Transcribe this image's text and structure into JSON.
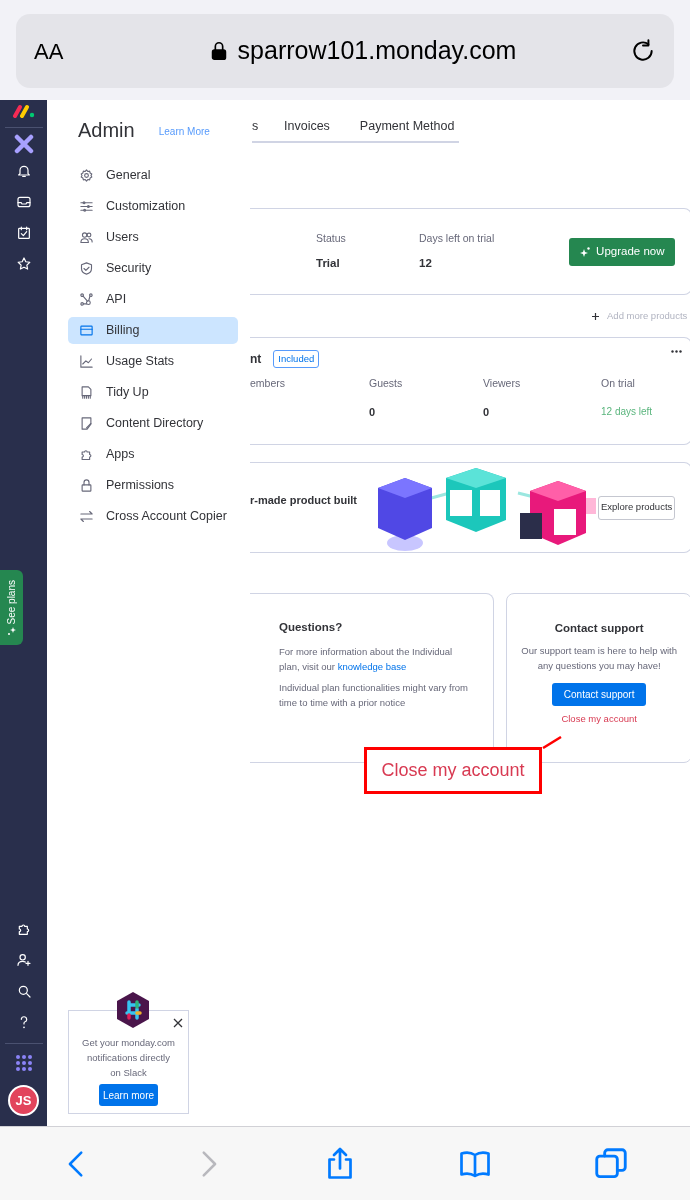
{
  "browser": {
    "text_size_label": "AA",
    "url": "sparrow101.monday.com"
  },
  "rail": {
    "see_plans": "See plans",
    "avatar": "JS"
  },
  "admin": {
    "title": "Admin",
    "learn_more": "Learn More",
    "menu": [
      {
        "label": "General",
        "selected": false
      },
      {
        "label": "Customization",
        "selected": false
      },
      {
        "label": "Users",
        "selected": false
      },
      {
        "label": "Security",
        "selected": false
      },
      {
        "label": "API",
        "selected": false
      },
      {
        "label": "Billing",
        "selected": true
      },
      {
        "label": "Usage Stats",
        "selected": false
      },
      {
        "label": "Tidy Up",
        "selected": false
      },
      {
        "label": "Content Directory",
        "selected": false
      },
      {
        "label": "Apps",
        "selected": false
      },
      {
        "label": "Permissions",
        "selected": false
      },
      {
        "label": "Cross Account Copier",
        "selected": false
      }
    ]
  },
  "tabs": [
    {
      "label": "s"
    },
    {
      "label": "Invoices"
    },
    {
      "label": "Payment Method"
    }
  ],
  "plan": {
    "stats": [
      {
        "label": "Status",
        "value": "Trial"
      },
      {
        "label": "Days left on trial",
        "value": "12"
      }
    ],
    "upgrade_button": "Upgrade now"
  },
  "add_products": "Add more products",
  "product": {
    "name": "nt",
    "badge": "Included",
    "columns": [
      {
        "label": "embers"
      },
      {
        "label": "Guests",
        "value": "0",
        "kind": "count"
      },
      {
        "label": "Viewers",
        "value": "0",
        "kind": "count"
      },
      {
        "label": "On trial",
        "value": "12 days left",
        "kind": "status"
      }
    ]
  },
  "promo": {
    "text": "r-made product built",
    "button": "Explore products"
  },
  "questions": {
    "title": "Questions?",
    "text": "For more information about the Individual plan, visit our",
    "link": "knowledge base",
    "note": "Individual plan functionalities might vary from time to time with a prior notice"
  },
  "support": {
    "title": "Contact support",
    "text": "Our support team is here to help with any questions you may have!",
    "button": "Contact support",
    "close_link": "Close my account"
  },
  "callout": "Close my account",
  "slack_popup": {
    "text": "Get your monday.com notifications directly on Slack",
    "button": "Learn more"
  },
  "toolbar": {
    "back_enabled": true,
    "forward_enabled": false
  }
}
